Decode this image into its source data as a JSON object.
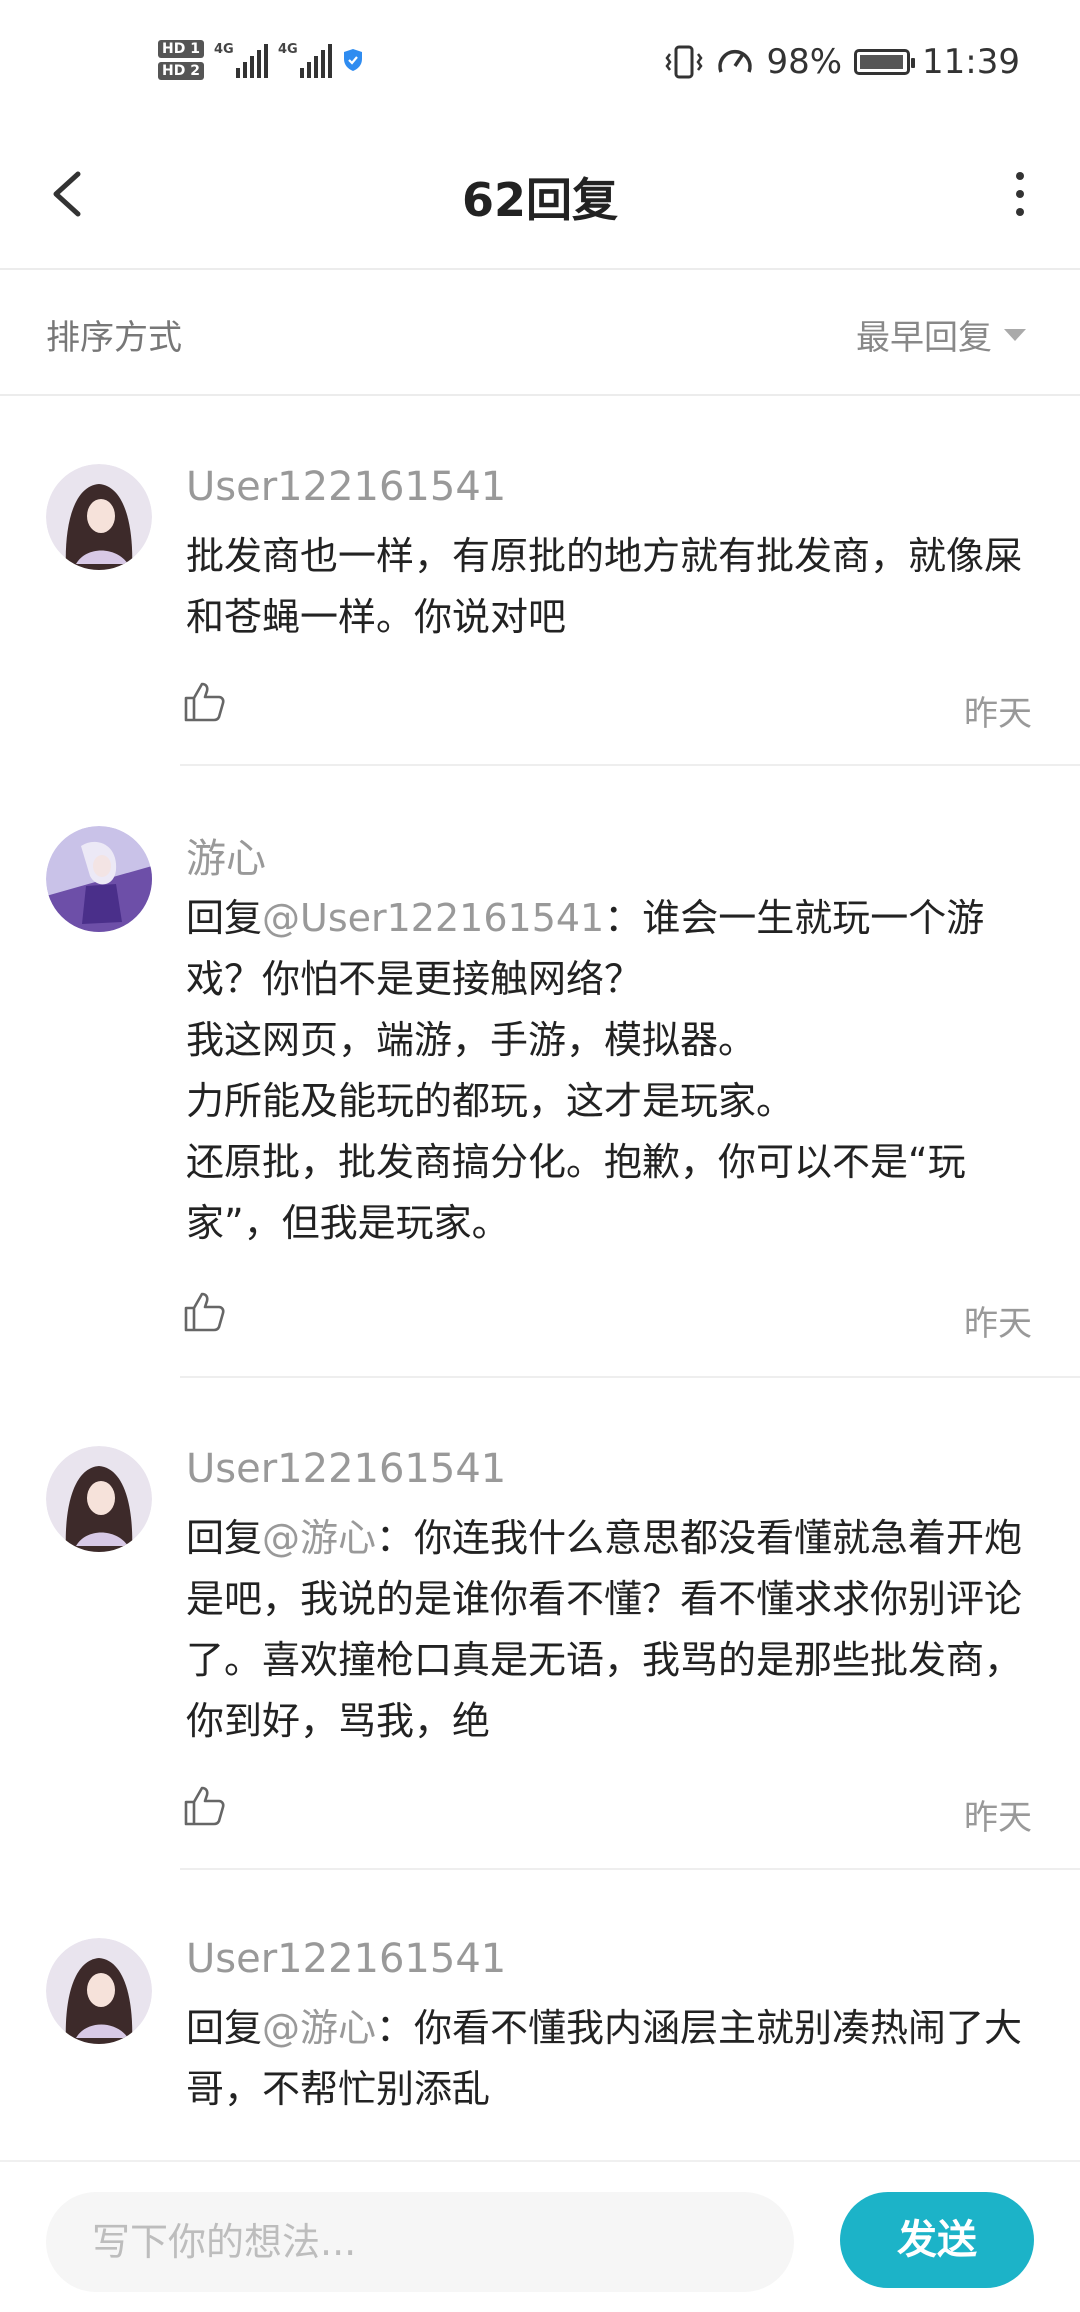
{
  "status_bar": {
    "hd1": "HD 1",
    "hd2": "HD 2",
    "net1": "4G",
    "net2": "4G",
    "battery_pct": "98%",
    "time": "11:39",
    "battery_level": 0.98
  },
  "header": {
    "title": "62回复"
  },
  "sort": {
    "label": "排序方式",
    "value": "最早回复"
  },
  "comments": [
    {
      "username": "User122161541",
      "reply_prefix": "",
      "mention": "",
      "text": "批发商也一样，有原批的地方就有批发商，就像屎和苍蝇一样。你说对吧",
      "time": "昨天",
      "avatar_theme": "dark-hair-girl"
    },
    {
      "username": "游心",
      "reply_prefix": "回复",
      "mention": "@User122161541",
      "text": "：谁会一生就玩一个游戏？你怕不是更接触网络？\n我这网页，端游，手游，模拟器。\n力所能及能玩的都玩，这才是玩家。\n还原批，批发商搞分化。抱歉，你可以不是“玩家”，但我是玩家。",
      "time": "昨天",
      "avatar_theme": "purple-anime-girl"
    },
    {
      "username": "User122161541",
      "reply_prefix": "回复",
      "mention": "@游心",
      "text": "：你连我什么意思都没看懂就急着开炮是吧，我说的是谁你看不懂？看不懂求求你别评论了。喜欢撞枪口真是无语，我骂的是那些批发商，你到好，骂我，绝",
      "time": "昨天",
      "avatar_theme": "dark-hair-girl"
    },
    {
      "username": "User122161541",
      "reply_prefix": "回复",
      "mention": "@游心",
      "text": "：你看不懂我内涵层主就别凑热闹了大哥，不帮忙别添乱",
      "time": "",
      "avatar_theme": "dark-hair-girl"
    }
  ],
  "composer": {
    "placeholder": "写下你的想法...",
    "send_label": "发送"
  },
  "colors": {
    "accent": "#1cb3c8",
    "muted_text": "#999999",
    "divider": "#eeeeee"
  }
}
